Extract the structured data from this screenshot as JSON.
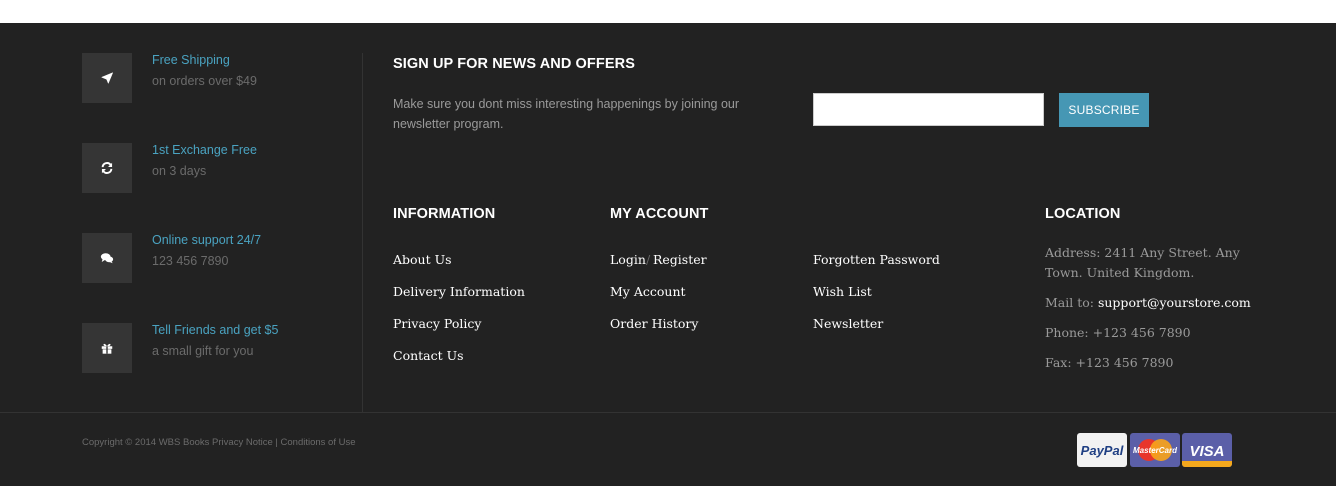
{
  "features": [
    {
      "title": "Free Shipping",
      "subtitle": "on orders over $49",
      "icon": "plane-icon"
    },
    {
      "title": "1st Exchange Free",
      "subtitle": "on 3 days",
      "icon": "refresh-icon"
    },
    {
      "title": "Online support 24/7",
      "subtitle": "123 456 7890",
      "icon": "comments-icon"
    },
    {
      "title": "Tell Friends and get $5",
      "subtitle": "a small gift for you",
      "icon": "gift-icon"
    }
  ],
  "newsletter": {
    "heading": "SIGN UP FOR NEWS AND OFFERS",
    "text": "Make sure you dont miss interesting happenings by joining our newsletter program.",
    "input_value": "",
    "button_label": "SUBSCRIBE"
  },
  "information": {
    "heading": "INFORMATION",
    "links": [
      "About Us",
      "Delivery Information",
      "Privacy Policy",
      "Contact Us"
    ]
  },
  "my_account": {
    "heading": "MY ACCOUNT",
    "login": "Login",
    "separator": "/",
    "register": "Register",
    "links": [
      "My Account",
      "Order History"
    ],
    "links_right": [
      "Forgotten Password",
      "Wish List",
      "Newsletter"
    ]
  },
  "location": {
    "heading": "LOCATION",
    "address_line1": "Address: 2411 Any Street. Any",
    "address_line2": "Town. United Kingdom.",
    "mail_label": "Mail to:",
    "mail_value": "support@yourstore.com",
    "phone": "Phone: +123 456 7890",
    "fax": "Fax: +123 456 7890"
  },
  "bottom": {
    "copyright": "Copyright © 2014 WBS Books",
    "privacy_link": "Privacy Notice",
    "separator": "|",
    "conditions_link": "Conditions of Use"
  },
  "payments": [
    {
      "label": "PayPal",
      "icon": "paypal-icon"
    },
    {
      "label": "MasterCard",
      "icon": "mastercard-icon"
    },
    {
      "label": "VISA",
      "icon": "visa-icon"
    }
  ],
  "colors": {
    "background": "#222222",
    "accent": "#4697b4",
    "feature_title": "#4aa3c1",
    "muted_text": "#9a9a9a"
  }
}
